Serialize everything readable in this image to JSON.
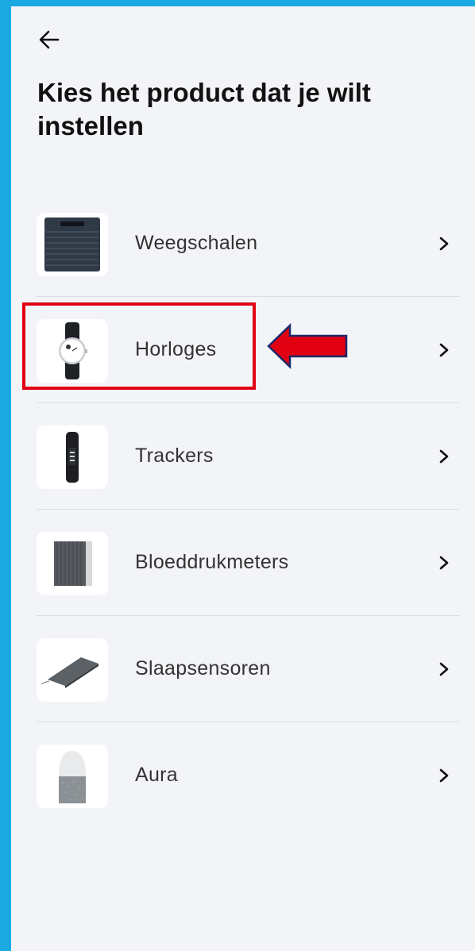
{
  "header": {
    "back_icon": "arrow-left-icon",
    "title": "Kies het product dat je wilt instellen"
  },
  "products": [
    {
      "label": "Weegschalen",
      "icon": "scale-icon"
    },
    {
      "label": "Horloges",
      "icon": "watch-icon"
    },
    {
      "label": "Trackers",
      "icon": "tracker-band-icon"
    },
    {
      "label": "Bloeddrukmeters",
      "icon": "blood-pressure-monitor-icon"
    },
    {
      "label": "Slaapsensoren",
      "icon": "sleep-sensor-mat-icon"
    },
    {
      "label": "Aura",
      "icon": "aura-lamp-icon"
    }
  ],
  "annotation": {
    "highlight_color": "#e00012",
    "arrow_fill": "#e00012",
    "arrow_stroke": "#1c2a6b",
    "highlighted_item": "Horloges"
  },
  "colors": {
    "frame": "#1aa9e0",
    "background": "#f3f4f8"
  }
}
